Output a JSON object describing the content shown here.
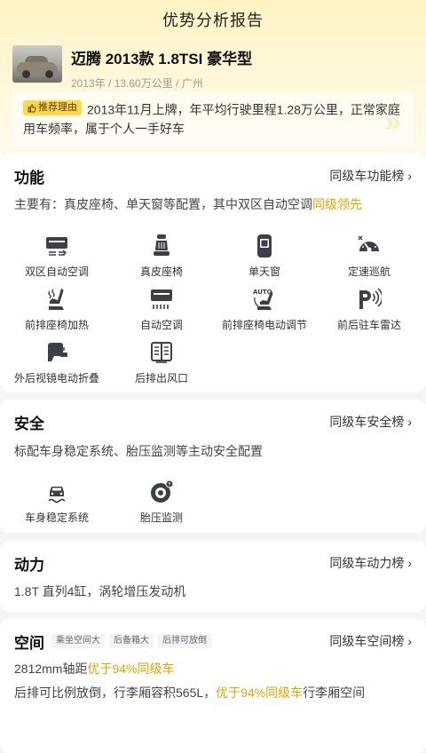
{
  "header": {
    "title": "优势分析报告"
  },
  "car": {
    "name": "迈腾 2013款 1.8TSI 豪华型",
    "meta": "2013年 / 13.60万公里 / 广州"
  },
  "reason": {
    "tag": "推荐理由",
    "text": "2013年11月上牌，年平均行驶里程1.28万公里，正常家庭用车频率，属于个人一手好车"
  },
  "function": {
    "title": "功能",
    "link": "同级车功能榜",
    "desc_prefix": "主要有：真皮座椅、单天窗等配置，其中双区自动空调",
    "desc_highlight": "同级领先",
    "items": [
      {
        "label": "双区自动空调",
        "icon": "dual-zone-ac-icon"
      },
      {
        "label": "真皮座椅",
        "icon": "leather-seat-icon"
      },
      {
        "label": "单天窗",
        "icon": "sunroof-icon"
      },
      {
        "label": "定速巡航",
        "icon": "cruise-control-icon"
      },
      {
        "label": "前排座椅加热",
        "icon": "seat-heating-icon"
      },
      {
        "label": "自动空调",
        "icon": "auto-ac-icon"
      },
      {
        "label": "前排座椅电动调节",
        "icon": "power-seat-icon"
      },
      {
        "label": "前后驻车雷达",
        "icon": "parking-radar-icon"
      },
      {
        "label": "外后视镜电动折叠",
        "icon": "mirror-fold-icon"
      },
      {
        "label": "后排出风口",
        "icon": "rear-vent-icon"
      }
    ]
  },
  "safety": {
    "title": "安全",
    "link": "同级车安全榜",
    "desc": "标配车身稳定系统、胎压监测等主动安全配置",
    "items": [
      {
        "label": "车身稳定系统",
        "icon": "stability-control-icon"
      },
      {
        "label": "胎压监测",
        "icon": "tire-pressure-icon"
      }
    ]
  },
  "power": {
    "title": "动力",
    "link": "同级车动力榜",
    "desc": "1.8T 直列4缸，涡轮增压发动机"
  },
  "space": {
    "title": "空间",
    "tags": [
      "乘坐空间大",
      "后备箱大",
      "后排可放倒"
    ],
    "link": "同级车空间榜",
    "line1_prefix": "2812mm轴距",
    "line1_highlight": "优于94%同级车",
    "line2_prefix": "后排可比例放倒，行李厢容积565L，",
    "line2_highlight": "优于94%同级车",
    "line2_suffix": "行李厢空间"
  },
  "colors": {
    "accent": "#e0a400",
    "tag_yellow": "#ffd94a",
    "icon": "#3c4048"
  }
}
